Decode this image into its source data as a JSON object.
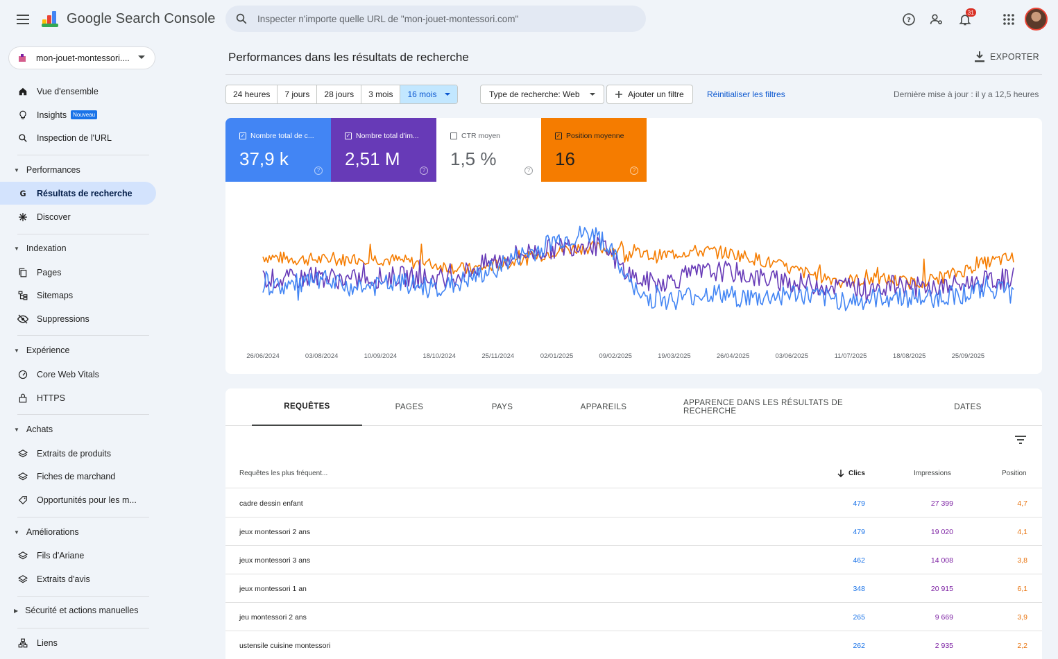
{
  "header": {
    "app_name": "Google Search Console",
    "search_placeholder": "Inspecter n'importe quelle URL de \"mon-jouet-montessori.com\"",
    "notifications_count": "31"
  },
  "sidebar": {
    "property": "mon-jouet-montessori....",
    "items": [
      {
        "label": "Vue d'ensemble"
      },
      {
        "label": "Insights",
        "badge": "Nouveau"
      },
      {
        "label": "Inspection de l'URL"
      }
    ],
    "sections": {
      "performances": "Performances",
      "indexation": "Indexation",
      "experience": "Expérience",
      "achats": "Achats",
      "ameliorations": "Améliorations",
      "securite": "Sécurité et actions manuelles"
    },
    "perf_items": [
      "Résultats de recherche",
      "Discover"
    ],
    "index_items": [
      "Pages",
      "Sitemaps",
      "Suppressions"
    ],
    "exp_items": [
      "Core Web Vitals",
      "HTTPS"
    ],
    "achats_items": [
      "Extraits de produits",
      "Fiches de marchand",
      "Opportunités pour les m..."
    ],
    "amelio_items": [
      "Fils d'Ariane",
      "Extraits d'avis"
    ],
    "links": "Liens"
  },
  "main": {
    "title": "Performances dans les résultats de recherche",
    "export_label": "EXPORTER",
    "ranges": [
      "24 heures",
      "7 jours",
      "28 jours",
      "3 mois",
      "16 mois"
    ],
    "selected_range": "16 mois",
    "search_type": "Type de recherche: Web",
    "add_filter": "Ajouter un filtre",
    "reset_filters": "Réinitialiser les filtres",
    "last_update": "Dernière mise à jour : il y a 12,5 heures"
  },
  "metrics": [
    {
      "label": "Nombre total de c...",
      "value": "37,9 k",
      "checked": true,
      "color": "#4285f4"
    },
    {
      "label": "Nombre total d'im...",
      "value": "2,51 M",
      "checked": true,
      "color": "#673ab7"
    },
    {
      "label": "CTR moyen",
      "value": "1,5 %",
      "checked": false,
      "color": "#ffffff"
    },
    {
      "label": "Position moyenne",
      "value": "16",
      "checked": true,
      "color": "#f57c00"
    }
  ],
  "chart_data": {
    "type": "line",
    "x_ticks": [
      "26/06/2024",
      "03/08/2024",
      "10/09/2024",
      "18/10/2024",
      "25/11/2024",
      "02/01/2025",
      "09/02/2025",
      "19/03/2025",
      "26/04/2025",
      "03/06/2025",
      "11/07/2025",
      "18/08/2025",
      "25/09/2025"
    ],
    "series": [
      {
        "metric": "clicks",
        "color": "#4285f4",
        "values": [
          0.38,
          0.35,
          0.37,
          0.39,
          0.37,
          0.35,
          0.35,
          0.36,
          0.38,
          0.36,
          0.34,
          0.36,
          0.4,
          0.45,
          0.52,
          0.58,
          0.62,
          0.7,
          0.72,
          0.75,
          0.7,
          0.48,
          0.28,
          0.26,
          0.25,
          0.28,
          0.3,
          0.29,
          0.27,
          0.26,
          0.28,
          0.3,
          0.28,
          0.26,
          0.25,
          0.24,
          0.26,
          0.28,
          0.27,
          0.26,
          0.28,
          0.3,
          0.32,
          0.34,
          0.36
        ]
      },
      {
        "metric": "impressions",
        "color": "#673ab7",
        "values": [
          0.42,
          0.4,
          0.41,
          0.43,
          0.42,
          0.4,
          0.41,
          0.42,
          0.43,
          0.42,
          0.41,
          0.42,
          0.47,
          0.52,
          0.56,
          0.6,
          0.62,
          0.64,
          0.66,
          0.68,
          0.64,
          0.5,
          0.4,
          0.38,
          0.4,
          0.44,
          0.46,
          0.47,
          0.45,
          0.42,
          0.4,
          0.38,
          0.37,
          0.36,
          0.35,
          0.34,
          0.35,
          0.36,
          0.35,
          0.34,
          0.35,
          0.37,
          0.39,
          0.4,
          0.42
        ]
      },
      {
        "metric": "position",
        "color": "#f57c00",
        "values": [
          0.58,
          0.57,
          0.56,
          0.56,
          0.55,
          0.56,
          0.57,
          0.56,
          0.55,
          0.53,
          0.52,
          0.5,
          0.48,
          0.5,
          0.52,
          0.55,
          0.58,
          0.62,
          0.64,
          0.65,
          0.64,
          0.62,
          0.6,
          0.58,
          0.6,
          0.62,
          0.62,
          0.61,
          0.59,
          0.56,
          0.52,
          0.48,
          0.45,
          0.42,
          0.4,
          0.4,
          0.41,
          0.4,
          0.38,
          0.4,
          0.43,
          0.47,
          0.52,
          0.55,
          0.57
        ]
      }
    ]
  },
  "tabs": [
    "REQUÊTES",
    "PAGES",
    "PAYS",
    "APPAREILS",
    "APPARENCE DANS LES RÉSULTATS DE RECHERCHE",
    "DATES"
  ],
  "table": {
    "headers": {
      "query": "Requêtes les plus fréquent...",
      "clicks": "Clics",
      "impressions": "Impressions",
      "position": "Position"
    },
    "rows": [
      {
        "query": "cadre dessin enfant",
        "clicks": "479",
        "impressions": "27 399",
        "position": "4,7"
      },
      {
        "query": "jeux montessori 2 ans",
        "clicks": "479",
        "impressions": "19 020",
        "position": "4,1"
      },
      {
        "query": "jeux montessori 3 ans",
        "clicks": "462",
        "impressions": "14 008",
        "position": "3,8"
      },
      {
        "query": "jeux montessori 1 an",
        "clicks": "348",
        "impressions": "20 915",
        "position": "6,1"
      },
      {
        "query": "jeu montessori 2 ans",
        "clicks": "265",
        "impressions": "9 669",
        "position": "3,9"
      },
      {
        "query": "ustensile cuisine montessori",
        "clicks": "262",
        "impressions": "2 935",
        "position": "2,2"
      }
    ]
  }
}
